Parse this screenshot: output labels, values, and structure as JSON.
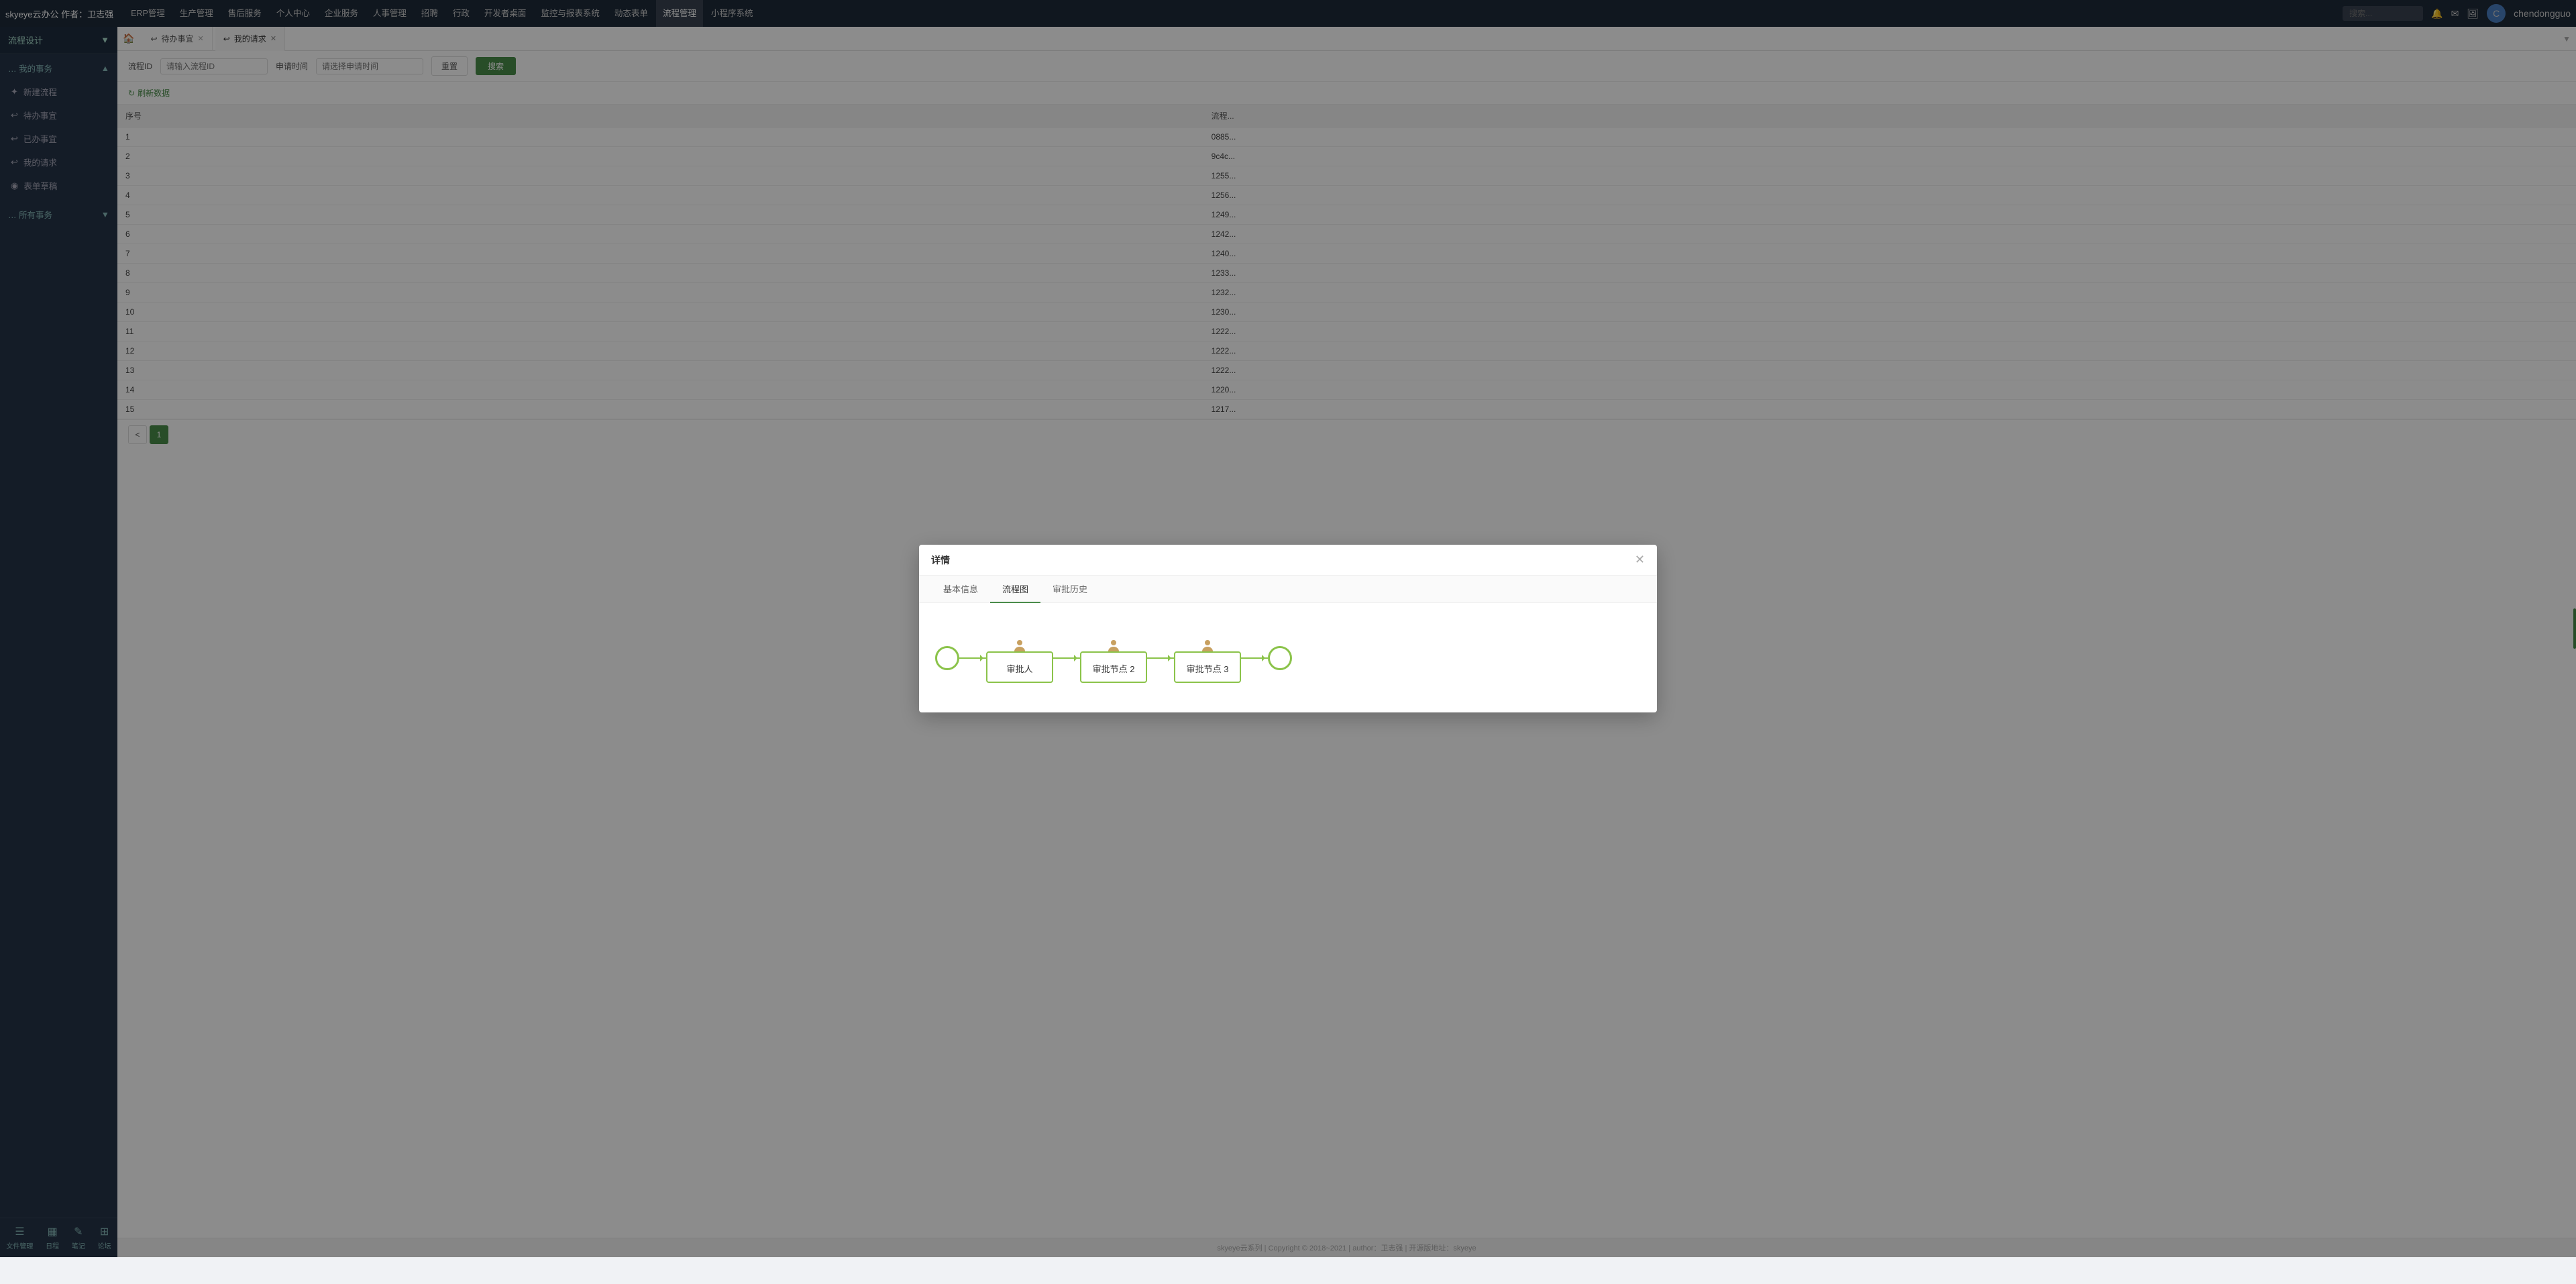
{
  "app": {
    "brand": "skyeye云办公 作者：卫志强",
    "username": "chendongguo"
  },
  "topnav": {
    "items": [
      {
        "label": "≡",
        "id": "menu-toggle"
      },
      {
        "label": "ERP管理",
        "id": "erp"
      },
      {
        "label": "生产管理",
        "id": "production"
      },
      {
        "label": "售后服务",
        "id": "aftersale"
      },
      {
        "label": "个人中心",
        "id": "personal"
      },
      {
        "label": "企业服务",
        "id": "enterprise"
      },
      {
        "label": "人事管理",
        "id": "hr"
      },
      {
        "label": "招聘",
        "id": "recruit"
      },
      {
        "label": "行政",
        "id": "admin"
      },
      {
        "label": "开发者桌面",
        "id": "dev"
      },
      {
        "label": "监控与报表系统",
        "id": "monitor"
      },
      {
        "label": "动态表单",
        "id": "dynamic"
      },
      {
        "label": "流程管理",
        "id": "workflow",
        "active": true
      },
      {
        "label": "小程序系统",
        "id": "miniapp"
      }
    ],
    "search_placeholder": "搜索..."
  },
  "sidebar": {
    "section_title": "流程设计",
    "my_affairs": "… 我的事务",
    "items": [
      {
        "icon": "✦",
        "label": "新建流程",
        "id": "new-flow"
      },
      {
        "icon": "↩",
        "label": "待办事宜",
        "id": "pending"
      },
      {
        "icon": "↩",
        "label": "已办事宜",
        "id": "done"
      },
      {
        "icon": "↩",
        "label": "我的请求",
        "id": "my-request"
      },
      {
        "icon": "◉",
        "label": "表单草稿",
        "id": "drafts"
      }
    ],
    "all_affairs": "… 所有事务",
    "bottom_items": [
      {
        "icon": "☰",
        "label": "文件管理"
      },
      {
        "icon": "▦",
        "label": "日程"
      },
      {
        "icon": "✎",
        "label": "笔记"
      },
      {
        "icon": "⊞",
        "label": "论坛"
      }
    ]
  },
  "tabs": [
    {
      "label": "待办事宜",
      "icon": "↩",
      "closable": true,
      "active": false
    },
    {
      "label": "我的请求",
      "icon": "↩",
      "closable": true,
      "active": true
    }
  ],
  "searchbar": {
    "flow_id_label": "流程ID",
    "flow_id_placeholder": "请输入流程ID",
    "apply_time_label": "申请时间",
    "apply_time_placeholder": "请选择申请时间",
    "reset_label": "重置",
    "search_label": "搜索"
  },
  "table": {
    "refresh_label": "刷新数据",
    "columns": [
      "序号",
      "流程..."
    ],
    "rows": [
      {
        "no": "1",
        "id": "0885..."
      },
      {
        "no": "2",
        "id": "9c4c..."
      },
      {
        "no": "3",
        "id": "1255..."
      },
      {
        "no": "4",
        "id": "1256..."
      },
      {
        "no": "5",
        "id": "1249..."
      },
      {
        "no": "6",
        "id": "1242..."
      },
      {
        "no": "7",
        "id": "1240..."
      },
      {
        "no": "8",
        "id": "1233..."
      },
      {
        "no": "9",
        "id": "1232..."
      },
      {
        "no": "10",
        "id": "1230..."
      },
      {
        "no": "11",
        "id": "1222..."
      },
      {
        "no": "12",
        "id": "1222..."
      },
      {
        "no": "13",
        "id": "1222..."
      },
      {
        "no": "14",
        "id": "1220..."
      },
      {
        "no": "15",
        "id": "1217..."
      }
    ]
  },
  "pagination": {
    "current": 1
  },
  "modal": {
    "title": "详情",
    "tabs": [
      {
        "label": "基本信息",
        "active": false
      },
      {
        "label": "流程图",
        "active": true
      },
      {
        "label": "审批历史",
        "active": false
      }
    ],
    "flow_diagram": {
      "nodes": [
        {
          "type": "start"
        },
        {
          "type": "node",
          "label": "审批人",
          "has_avatar": true
        },
        {
          "type": "node",
          "label": "审批节点 2",
          "has_avatar": true
        },
        {
          "type": "node",
          "label": "审批节点 3",
          "has_avatar": true
        },
        {
          "type": "end"
        }
      ]
    }
  },
  "footer": {
    "text": "skyeye云系列 | Copyright © 2018~2021 | author：卫志强 | 开源版地址：skyeye"
  }
}
